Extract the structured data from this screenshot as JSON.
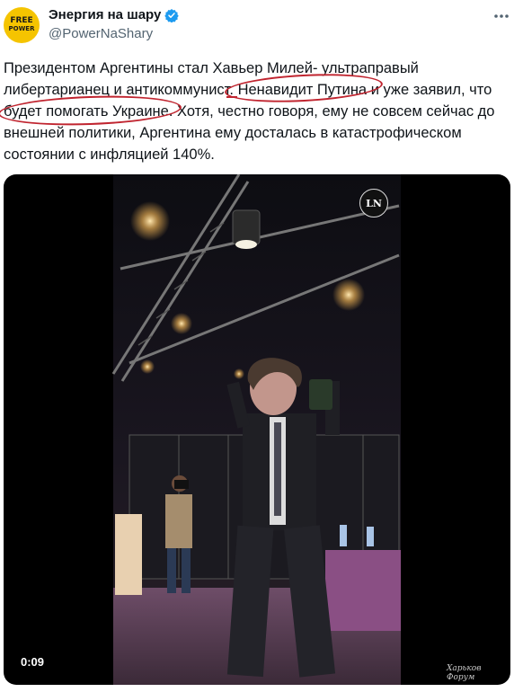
{
  "author": {
    "avatar_lines": [
      "FREE",
      "POWER"
    ],
    "name": "Энергия на шару",
    "handle": "@PowerNaShary"
  },
  "tweet": {
    "lines": [
      "Президентом Аргентины стал Хавьер Милей- ультраправый",
      "либертарианец и антикоммунист. Ненавидит Путина и уже заявил, что",
      "будет помогать Украине. Хотя, честно говоря, ему не совсем сейчас до",
      "внешней политики, Аргентина ему досталась в катастрофическом",
      "состоянии с инфляцией 140%."
    ]
  },
  "video": {
    "timestamp": "0:09",
    "channel_logo": "LN",
    "watermark": "Харьков Форум"
  },
  "colors": {
    "verified": "#1d9bf0",
    "annotation": "#c0242f",
    "avatar": "#f5c400"
  },
  "icons": [
    "verified-badge-icon",
    "more-options-icon"
  ]
}
